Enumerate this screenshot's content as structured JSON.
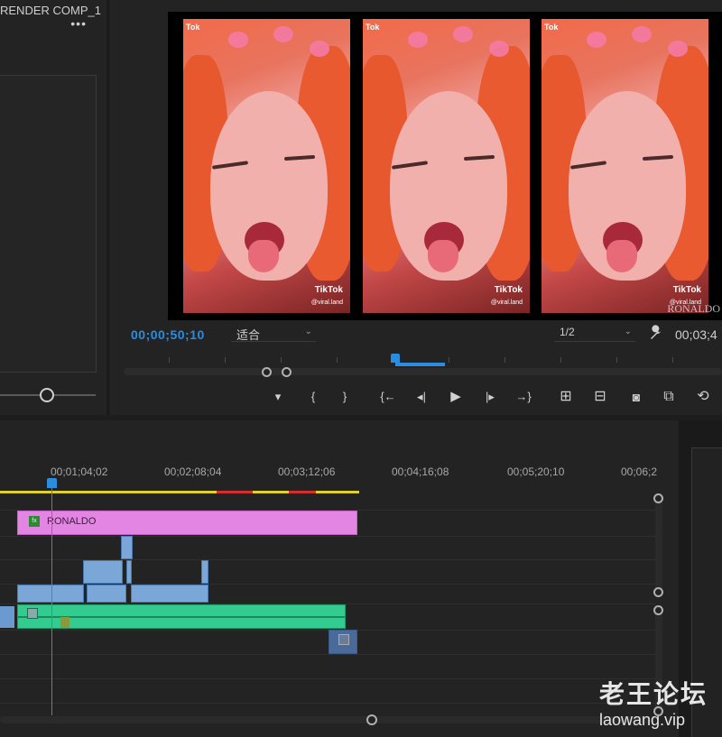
{
  "source_panel": {
    "title": "RENDER COMP_1",
    "menu_label": "•••"
  },
  "program_monitor": {
    "clips": [
      {
        "tok_label": "Tok",
        "tiktok_label": "TikTok",
        "handle": "@viral.land"
      },
      {
        "tok_label": "Tok",
        "tiktok_label": "TikTok",
        "handle": "@viral.land"
      },
      {
        "tok_label": "Tok",
        "tiktok_label": "TikTok",
        "handle": "@viral.land"
      }
    ],
    "overlay_text": "RONALDO",
    "current_timecode": "00;00;50;10",
    "fit_select": "适合",
    "resolution_select": "1/2",
    "duration_timecode": "00;03;4",
    "accent_color": "#2c8de0"
  },
  "transport": {
    "mark_in": "▾",
    "brace_open": "{",
    "brace_close": "}",
    "go_to_in": "{←",
    "step_back": "◂|",
    "play": "▶",
    "step_forward": "|▸",
    "go_to_out": "→}",
    "lift": "⊞",
    "extract": "⊟",
    "export_frame": "◙",
    "compare": "⧉",
    "button_editor": "⟲"
  },
  "timeline": {
    "ruler_labels": [
      "00;01;04;02",
      "00;02;08;04",
      "00;03;12;06",
      "00;04;16;08",
      "00;05;20;10",
      "00;06;2"
    ],
    "clip_ronaldo_label": "RONALDO",
    "clip_fx_label": "fx",
    "clip_color": "#e385e3",
    "audio_color": "#33cc90"
  },
  "watermark": {
    "chinese": "老王论坛",
    "url": "laowang.vip"
  }
}
